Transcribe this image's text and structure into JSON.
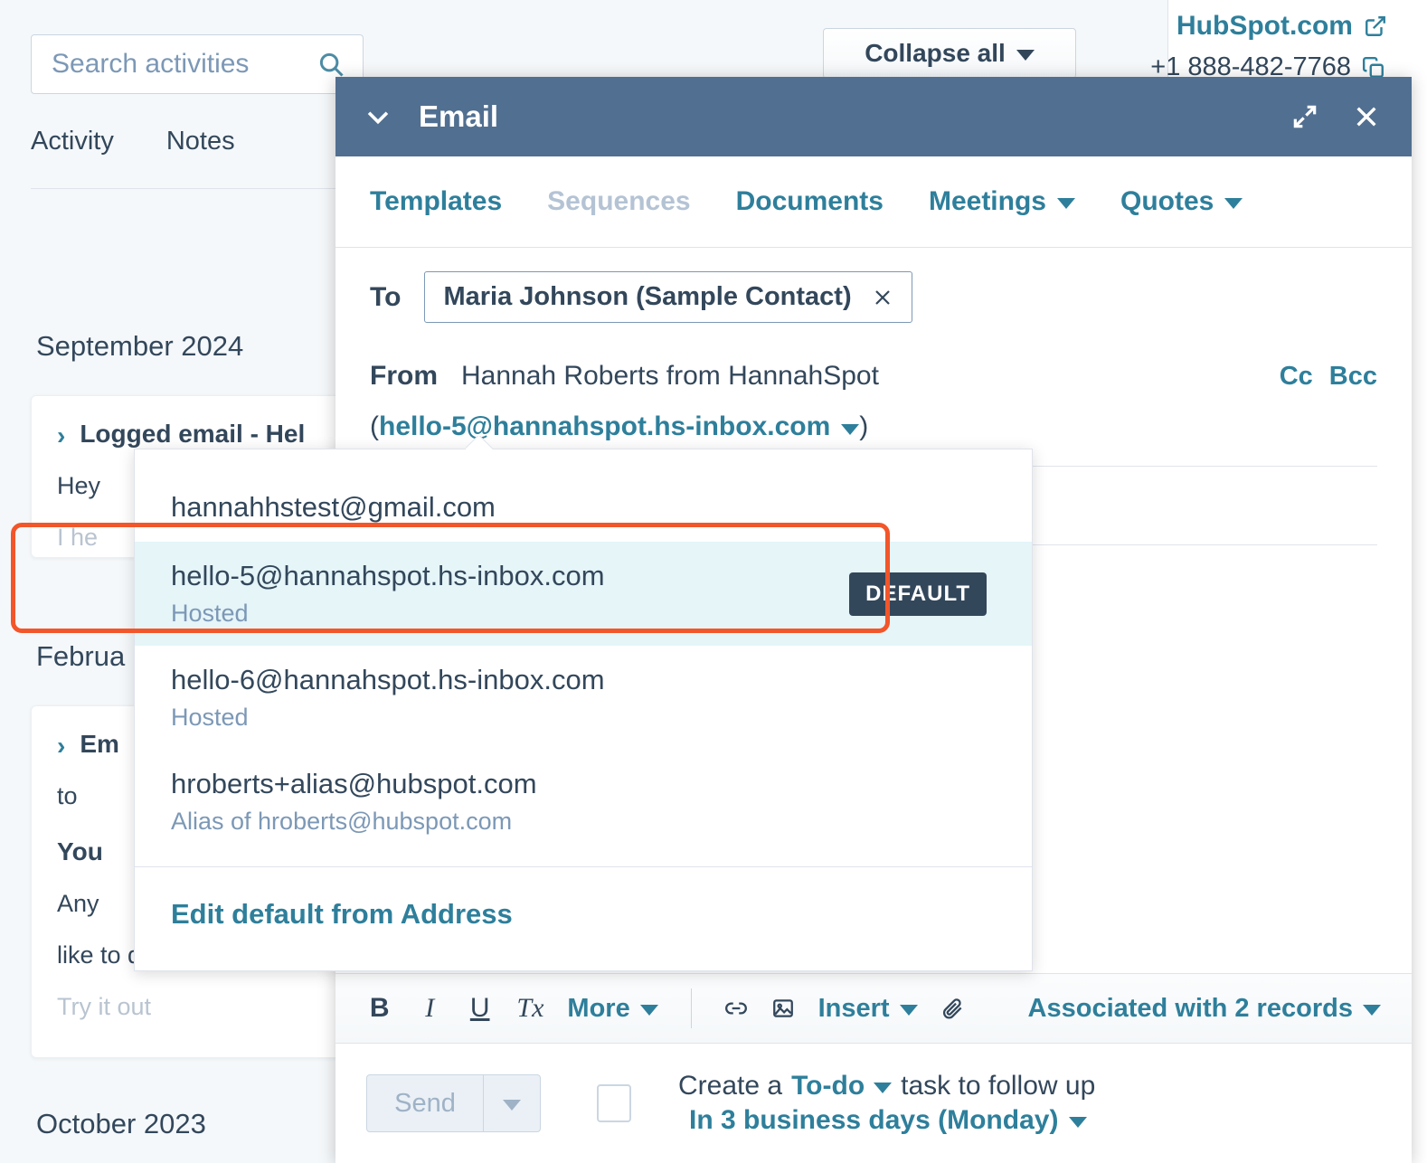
{
  "background": {
    "search": {
      "placeholder": "Search activities",
      "value": "",
      "icon": "search-icon"
    },
    "tabs": [
      {
        "label": "Activity"
      },
      {
        "label": "Notes"
      }
    ],
    "collapse_all_label": "Collapse all",
    "right_panel": {
      "website_link": "HubSpot.com",
      "phone": "+1 888-482-7768"
    },
    "timeline": [
      {
        "month": "September 2024",
        "entry_title": "Logged email - Hel",
        "lines": [
          "Hey",
          "I he"
        ]
      },
      {
        "month": "Februa",
        "entry_title": "Em",
        "lines": [
          "to ",
          "You",
          "Any",
          "like to do next.",
          "Try it out"
        ]
      },
      {
        "month": "October 2023",
        "entry_title": "",
        "lines": []
      }
    ]
  },
  "composer": {
    "title": "Email",
    "header_icons": {
      "collapse": "chevron-down-icon",
      "expand": "expand-icon",
      "close": "close-icon"
    },
    "tools": [
      {
        "label": "Templates",
        "disabled": false,
        "caret": false
      },
      {
        "label": "Sequences",
        "disabled": true,
        "caret": false
      },
      {
        "label": "Documents",
        "disabled": false,
        "caret": false
      },
      {
        "label": "Meetings",
        "disabled": false,
        "caret": true
      },
      {
        "label": "Quotes",
        "disabled": false,
        "caret": true
      }
    ],
    "to": {
      "label": "To",
      "chip": "Maria Johnson (Sample Contact)"
    },
    "from": {
      "label": "From",
      "name": "Hannah Roberts from HannahSpot",
      "address": "hello-5@hannahspot.hs-inbox.com",
      "open_paren": "(",
      "close_paren": ")"
    },
    "cc_label": "Cc",
    "bcc_label": "Bcc",
    "editor_toolbar": {
      "bold": "B",
      "italic": "I",
      "underline": "U",
      "clear_format": "Tx",
      "more_label": "More",
      "insert_label": "Insert",
      "associated_label": "Associated with 2 records"
    },
    "send": {
      "button_label": "Send",
      "followup_prefix": "Create a",
      "followup_type": "To-do",
      "followup_suffix": "task to follow up",
      "followup_due": "In 3 business days (Monday)"
    }
  },
  "from_dropdown": {
    "items": [
      {
        "email": "hannahhstest@gmail.com",
        "sub": "",
        "badge": "",
        "selected": false
      },
      {
        "email": "hello-5@hannahspot.hs-inbox.com",
        "sub": "Hosted",
        "badge": "DEFAULT",
        "selected": true
      },
      {
        "email": "hello-6@hannahspot.hs-inbox.com",
        "sub": "Hosted",
        "badge": "",
        "selected": false
      },
      {
        "email": "hroberts+alias@hubspot.com",
        "sub": "Alias of hroberts@hubspot.com",
        "badge": "",
        "selected": false
      }
    ],
    "edit_link": "Edit default from Address"
  },
  "colors": {
    "header_bar": "#516f90",
    "link": "#2e7f9b",
    "text": "#33475b",
    "muted": "#7c98b6",
    "highlight_row": "#e5f5f8",
    "highlight_outline": "#f2562a",
    "badge_bg": "#33475b"
  }
}
